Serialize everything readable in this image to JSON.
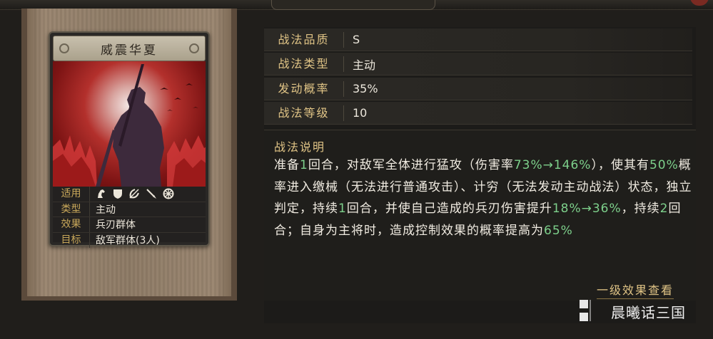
{
  "skill_card": {
    "title": "威震华夏",
    "attributes": [
      {
        "label": "适用",
        "value": "",
        "icons": [
          "cavalry-icon",
          "shield-icon",
          "bow-icon",
          "spear-icon",
          "chariot-wheel-icon"
        ]
      },
      {
        "label": "类型",
        "value": "主动"
      },
      {
        "label": "效果",
        "value": "兵刃群体"
      },
      {
        "label": "目标",
        "value": "敌军群体(3人)"
      }
    ]
  },
  "info": {
    "rows": [
      {
        "label": "战法品质",
        "value": "S"
      },
      {
        "label": "战法类型",
        "value": "主动"
      },
      {
        "label": "发动概率",
        "value": "35%"
      },
      {
        "label": "战法等级",
        "value": "10"
      }
    ]
  },
  "description": {
    "title": "战法说明",
    "segments": [
      {
        "t": "准备"
      },
      {
        "t": "1",
        "n": true
      },
      {
        "t": "回合，对敌军全体进行猛攻（伤害率"
      },
      {
        "t": "73%→146%",
        "n": true
      },
      {
        "t": "），使其有"
      },
      {
        "t": "50%",
        "n": true
      },
      {
        "t": "概率进入缴械（无法进行普通攻击）、计穷（无法发动主动战法）状态，独立判定，持续"
      },
      {
        "t": "1",
        "n": true
      },
      {
        "t": "回合，并使自己造成的兵刃伤害提升"
      },
      {
        "t": "18%→36%",
        "n": true
      },
      {
        "t": "，持续"
      },
      {
        "t": "2",
        "n": true
      },
      {
        "t": "回合；自身为主将时，造成控制效果的概率提高为"
      },
      {
        "t": "65%",
        "n": true
      }
    ]
  },
  "links": {
    "first_level_effect": "一级效果查看"
  },
  "watermark": {
    "text": "晨曦话三国"
  },
  "colors": {
    "gold": "#e0c486",
    "green_number": "#7dd08b",
    "label_gold": "#c9a85a"
  }
}
